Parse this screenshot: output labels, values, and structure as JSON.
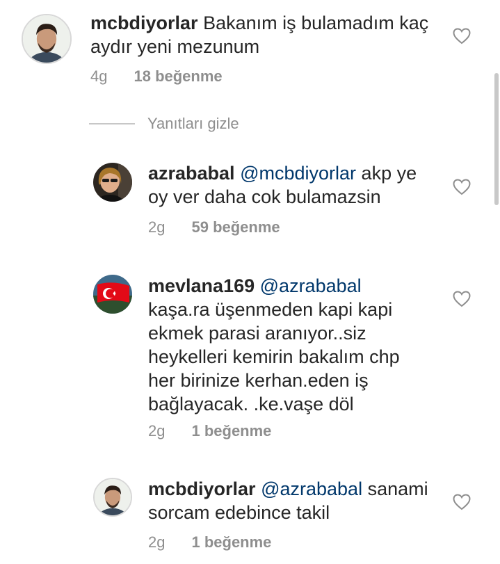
{
  "comments": [
    {
      "username": "mcbdiyorlar",
      "mention": "",
      "text": "Bakanım iş bulamadım kaç aydır yeni mezunum",
      "time": "4g",
      "likes": "18 beğenme"
    },
    {
      "username": "azrababal",
      "mention": "@mcbdiyorlar",
      "text": "akp ye oy ver daha cok bulamazsin",
      "time": "2g",
      "likes": "59 beğenme"
    },
    {
      "username": "mevlana169",
      "mention": "@azrababal",
      "text": "kaşa.ra üşenmeden kapi kapi ekmek parasi aranıyor..siz heykelleri kemirin bakalım chp her birinize kerhan.eden iş bağlayacak. .ke.vaşe döl",
      "time": "2g",
      "likes": "1 beğenme"
    },
    {
      "username": "mcbdiyorlar",
      "mention": "@azrababal",
      "text": "sanami sorcam edebince takil",
      "time": "2g",
      "likes": "1 beğenme"
    }
  ],
  "replies_toggle": "Yanıtları gizle",
  "icons": {
    "like": "heart-outline-icon",
    "avatar_flag": "turkish-flag"
  },
  "colors": {
    "mention": "#00376b",
    "secondary": "#8e8e8e",
    "text": "#262626",
    "flag_red": "#e30a17"
  }
}
